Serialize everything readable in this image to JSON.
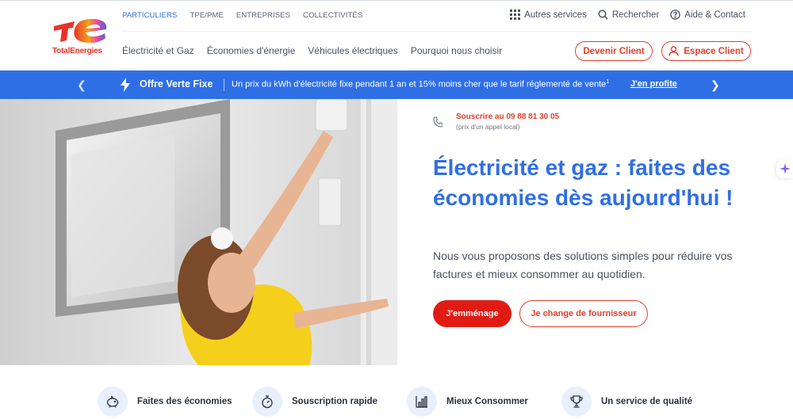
{
  "brand": {
    "name": "TotalEnergies"
  },
  "topnav": [
    {
      "label": "PARTICULIERS",
      "active": true
    },
    {
      "label": "TPE/PME",
      "active": false
    },
    {
      "label": "ENTREPRISES",
      "active": false
    },
    {
      "label": "COLLECTIVITÉS",
      "active": false
    }
  ],
  "utilnav": {
    "services": "Autres services",
    "search": "Rechercher",
    "help": "Aide & Contact"
  },
  "mainnav": [
    "Électricité et Gaz",
    "Économies d'énergie",
    "Véhicules électriques",
    "Pourquoi nous choisir"
  ],
  "header_buttons": {
    "devenir": "Devenir Client",
    "espace": "Espace Client"
  },
  "banner": {
    "title": "Offre Verte Fixe",
    "text": "Un prix du kWh d'électricité fixe pendant 1 an et 15% moins cher que le tarif réglementé de vente",
    "footnote": "1",
    "cta": "J'en profite"
  },
  "hero": {
    "phone_label": "Souscrire au 09 88 81 30 05",
    "phone_note": "(prix d'un appel local)",
    "headline": "Électricité et gaz : faites des économies dès aujourd'hui !",
    "subtext": "Nous vous proposons des solutions simples pour réduire vos factures et mieux consommer au quotidien.",
    "primary_cta": "J'emménage",
    "secondary_cta": "Je change de fournisseur"
  },
  "features": [
    {
      "icon": "piggy-bank-icon",
      "label": "Faites des économies"
    },
    {
      "icon": "stopwatch-icon",
      "label": "Souscription rapide"
    },
    {
      "icon": "bar-chart-icon",
      "label": "Mieux Consommer"
    },
    {
      "icon": "trophy-icon",
      "label": "Un service de qualité"
    }
  ],
  "colors": {
    "brand_red": "#e2402f",
    "brand_blue": "#2f6fe6",
    "feature_bg": "#e8effd"
  }
}
